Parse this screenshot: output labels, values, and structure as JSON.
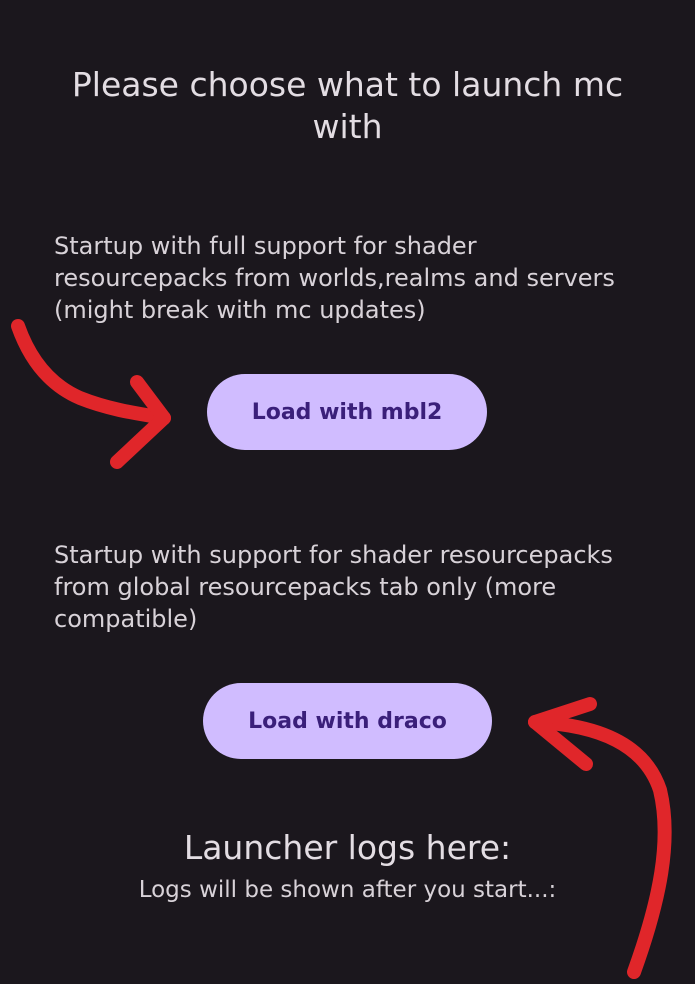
{
  "header": {
    "title": "Please choose what to launch mc with"
  },
  "options": [
    {
      "description": "Startup with full support for shader resourcepacks from worlds,realms and servers (might break with mc updates)",
      "button_label": "Load with mbl2"
    },
    {
      "description": "Startup with support for shader resourcepacks from global resourcepacks tab only (more compatible)",
      "button_label": "Load with draco"
    }
  ],
  "logs": {
    "title": "Launcher logs here:",
    "text": "Logs will be shown after you start...:"
  },
  "annotations": {
    "arrow_color": "#e0262a",
    "arrow_1": "red-arrow-pointing-to-mbl2-button",
    "arrow_2": "red-arrow-pointing-to-draco-button"
  },
  "colors": {
    "background": "#1b171d",
    "button_fill": "#d0bcff",
    "button_text": "#3a1f7a"
  }
}
